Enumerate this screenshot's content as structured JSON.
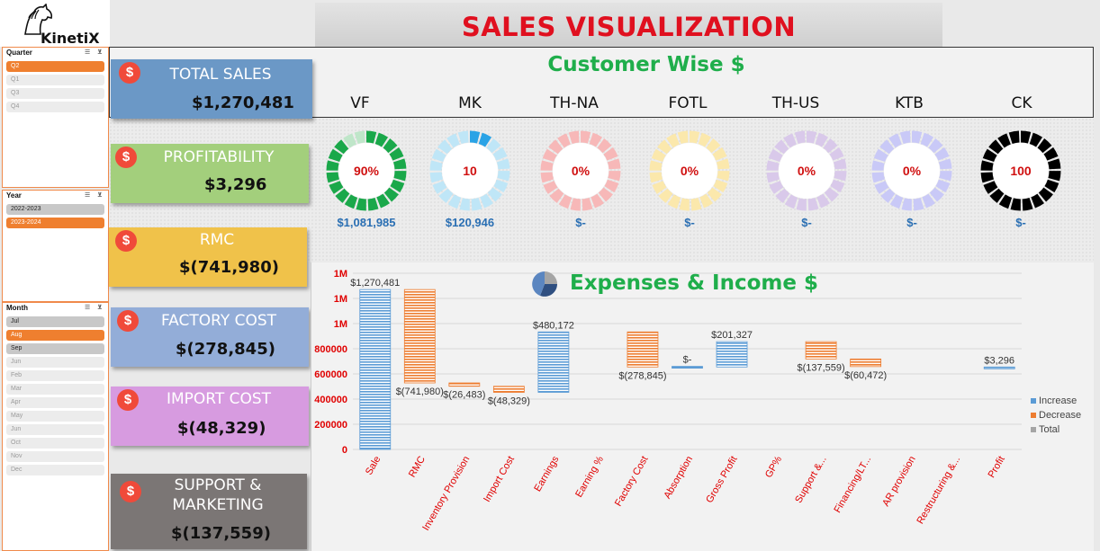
{
  "header": {
    "brand": "KinetiX",
    "title": "SALES VISUALIZATION"
  },
  "slicers": [
    {
      "title": "Quarter",
      "items": [
        {
          "label": "Q2",
          "state": "sel"
        },
        {
          "label": "Q1",
          "state": "dim"
        },
        {
          "label": "Q3",
          "state": "dim"
        },
        {
          "label": "Q4",
          "state": "dim"
        }
      ]
    },
    {
      "title": "Year",
      "items": [
        {
          "label": "2022-2023",
          "state": "avail"
        },
        {
          "label": "2023-2024",
          "state": "sel"
        }
      ]
    },
    {
      "title": "Month",
      "items": [
        {
          "label": "Jul",
          "state": "avail"
        },
        {
          "label": "Aug",
          "state": "sel"
        },
        {
          "label": "Sep",
          "state": "avail"
        },
        {
          "label": "Jun",
          "state": "dim"
        },
        {
          "label": "Feb",
          "state": "dim"
        },
        {
          "label": "Mar",
          "state": "dim"
        },
        {
          "label": "Apr",
          "state": "dim"
        },
        {
          "label": "May",
          "state": "dim"
        },
        {
          "label": "Jun",
          "state": "dim"
        },
        {
          "label": "Oct",
          "state": "dim"
        },
        {
          "label": "Nov",
          "state": "dim"
        },
        {
          "label": "Dec",
          "state": "dim"
        }
      ]
    }
  ],
  "kpis": [
    {
      "label": "TOTAL SALES",
      "value": "$1,270,481",
      "color": "#6b98c6"
    },
    {
      "label": "PROFITABILITY",
      "value": "$3,296",
      "color": "#a3cf7c"
    },
    {
      "label": "RMC",
      "value": "$(741,980)",
      "color": "#f0c24a"
    },
    {
      "label": "FACTORY COST",
      "value": "$(278,845)",
      "color": "#93add8"
    },
    {
      "label": "IMPORT COST",
      "value": "$(48,329)",
      "color": "#d79be0"
    },
    {
      "label": "SUPPORT &\nMARKETING",
      "value": "$(137,559)",
      "color": "#7b7675"
    }
  ],
  "customer_panel": {
    "title": "Customer Wise  $",
    "customers": [
      {
        "name": "VF",
        "pct_label": "90%",
        "value": "$1,081,985",
        "fill": 0.9,
        "color": "#1aa84a",
        "track": "#bfe6c9",
        "label_color": "#d01010"
      },
      {
        "name": "MK",
        "pct_label": "10",
        "value": "$120,946",
        "fill": 0.1,
        "color": "#2aa3e6",
        "track": "#bfe6f7",
        "label_color": "#d01010"
      },
      {
        "name": "TH-NA",
        "pct_label": "0%",
        "value": "$-",
        "fill": 0,
        "color": "#f7b3b3",
        "track": "#f7b8b8",
        "label_color": "#d01010"
      },
      {
        "name": "FOTL",
        "pct_label": "0%",
        "value": "$-",
        "fill": 0,
        "color": "#fbe8ac",
        "track": "#fbe8ac",
        "label_color": "#d01010"
      },
      {
        "name": "TH-US",
        "pct_label": "0%",
        "value": "$-",
        "fill": 0,
        "color": "#d9c9ea",
        "track": "#d9c9ea",
        "label_color": "#d01010"
      },
      {
        "name": "KTB",
        "pct_label": "0%",
        "value": "$-",
        "fill": 0,
        "color": "#c9c9f7",
        "track": "#c9c9f7",
        "label_color": "#d01010"
      },
      {
        "name": "CK",
        "pct_label": "100",
        "value": "$-",
        "fill": 1,
        "color": "#000000",
        "track": "#000000",
        "label_color": "#d01010"
      }
    ]
  },
  "chart_data": {
    "type": "bar",
    "subtype": "waterfall",
    "title": "Expenses & Income  $",
    "categories": [
      "Sale",
      "RMC",
      "Inventory Provision",
      "Import Cost",
      "Earnings",
      "Earning %",
      "Factory Cost",
      "Absorption",
      "Gross Profit",
      "GP%",
      "Support &...",
      "Financing/LT...",
      "AR provision",
      "Restructuring &...",
      "Profit"
    ],
    "bars": [
      {
        "kind": "increase",
        "start": 0,
        "end": 1270481,
        "label": "$1,270,481"
      },
      {
        "kind": "decrease",
        "start": 1270481,
        "end": 528501,
        "label": "$(741,980)"
      },
      {
        "kind": "decrease",
        "start": 528501,
        "end": 502018,
        "label": "$(26,483)"
      },
      {
        "kind": "decrease",
        "start": 502018,
        "end": 453689,
        "label": "$(48,329)"
      },
      {
        "kind": "increase",
        "start": 453689,
        "end": 933861,
        "label": "$480,172"
      },
      {
        "kind": "none",
        "start": 0,
        "end": 0,
        "label": ""
      },
      {
        "kind": "decrease",
        "start": 933861,
        "end": 655016,
        "label": "$(278,845)"
      },
      {
        "kind": "increase",
        "start": 655016,
        "end": 660016,
        "label": "$-"
      },
      {
        "kind": "increase",
        "start": 655016,
        "end": 856343,
        "label": "$201,327"
      },
      {
        "kind": "none",
        "start": 0,
        "end": 0,
        "label": ""
      },
      {
        "kind": "decrease",
        "start": 856343,
        "end": 718784,
        "label": "$(137,559)"
      },
      {
        "kind": "decrease",
        "start": 718784,
        "end": 658312,
        "label": "$(60,472)"
      },
      {
        "kind": "none",
        "start": 0,
        "end": 0,
        "label": ""
      },
      {
        "kind": "none",
        "start": 0,
        "end": 0,
        "label": ""
      },
      {
        "kind": "increase",
        "start": 650000,
        "end": 655000,
        "label": "$3,296"
      }
    ],
    "yticks": [
      {
        "v": 0,
        "label": "0"
      },
      {
        "v": 200000,
        "label": "200000"
      },
      {
        "v": 400000,
        "label": "400000"
      },
      {
        "v": 600000,
        "label": "600000"
      },
      {
        "v": 800000,
        "label": "800000"
      },
      {
        "v": 1000000,
        "label": "1M"
      },
      {
        "v": 1200000,
        "label": "1M"
      },
      {
        "v": 1400000,
        "label": "1M"
      }
    ],
    "ylim": [
      0,
      1400000
    ],
    "legend": [
      {
        "name": "Increase",
        "color": "#5b9bd5"
      },
      {
        "name": "Decrease",
        "color": "#ed7d31"
      },
      {
        "name": "Total",
        "color": "#a5a5a5"
      }
    ],
    "colors": {
      "increase": "#5b9bd5",
      "decrease": "#ed7d31",
      "axis_label": "#e00000"
    }
  }
}
